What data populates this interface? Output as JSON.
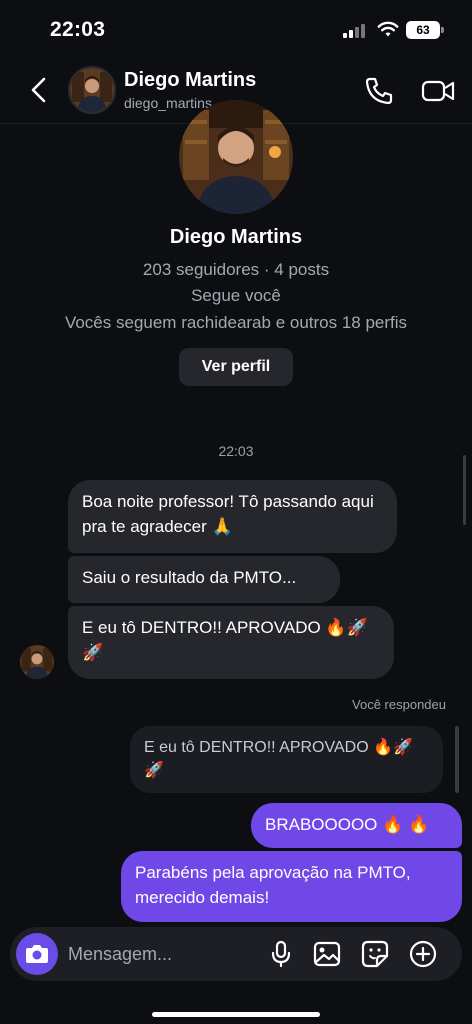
{
  "status_bar": {
    "time": "22:03",
    "battery": "63"
  },
  "header": {
    "name": "Diego Martins",
    "username": "diego_martins_"
  },
  "profile": {
    "name": "Diego Martins",
    "stats": "203 seguidores · 4 posts",
    "follows_you": "Segue você",
    "mutual": "Vocês seguem rachidearab e outros 18 perfis",
    "view_profile_label": "Ver perfil"
  },
  "conversation": {
    "timestamp": "22:03",
    "incoming": [
      "Boa noite professor! Tô passando aqui pra te agradecer 🙏",
      "Saiu o resultado da PMTO...",
      "E eu tô DENTRO!! APROVADO 🔥🚀 🚀"
    ],
    "replied_label": "Você respondeu",
    "reply_quote": "E eu tô DENTRO!! APROVADO 🔥🚀🚀",
    "outgoing": [
      "BRABOOOOO 🔥 🔥",
      "Parabéns pela aprovação na PMTO, merecido demais!"
    ]
  },
  "composer": {
    "placeholder": "Mensagem..."
  },
  "colors": {
    "accent": "#7048e8",
    "background": "#0d0e12",
    "incoming_bubble": "#26272c"
  }
}
